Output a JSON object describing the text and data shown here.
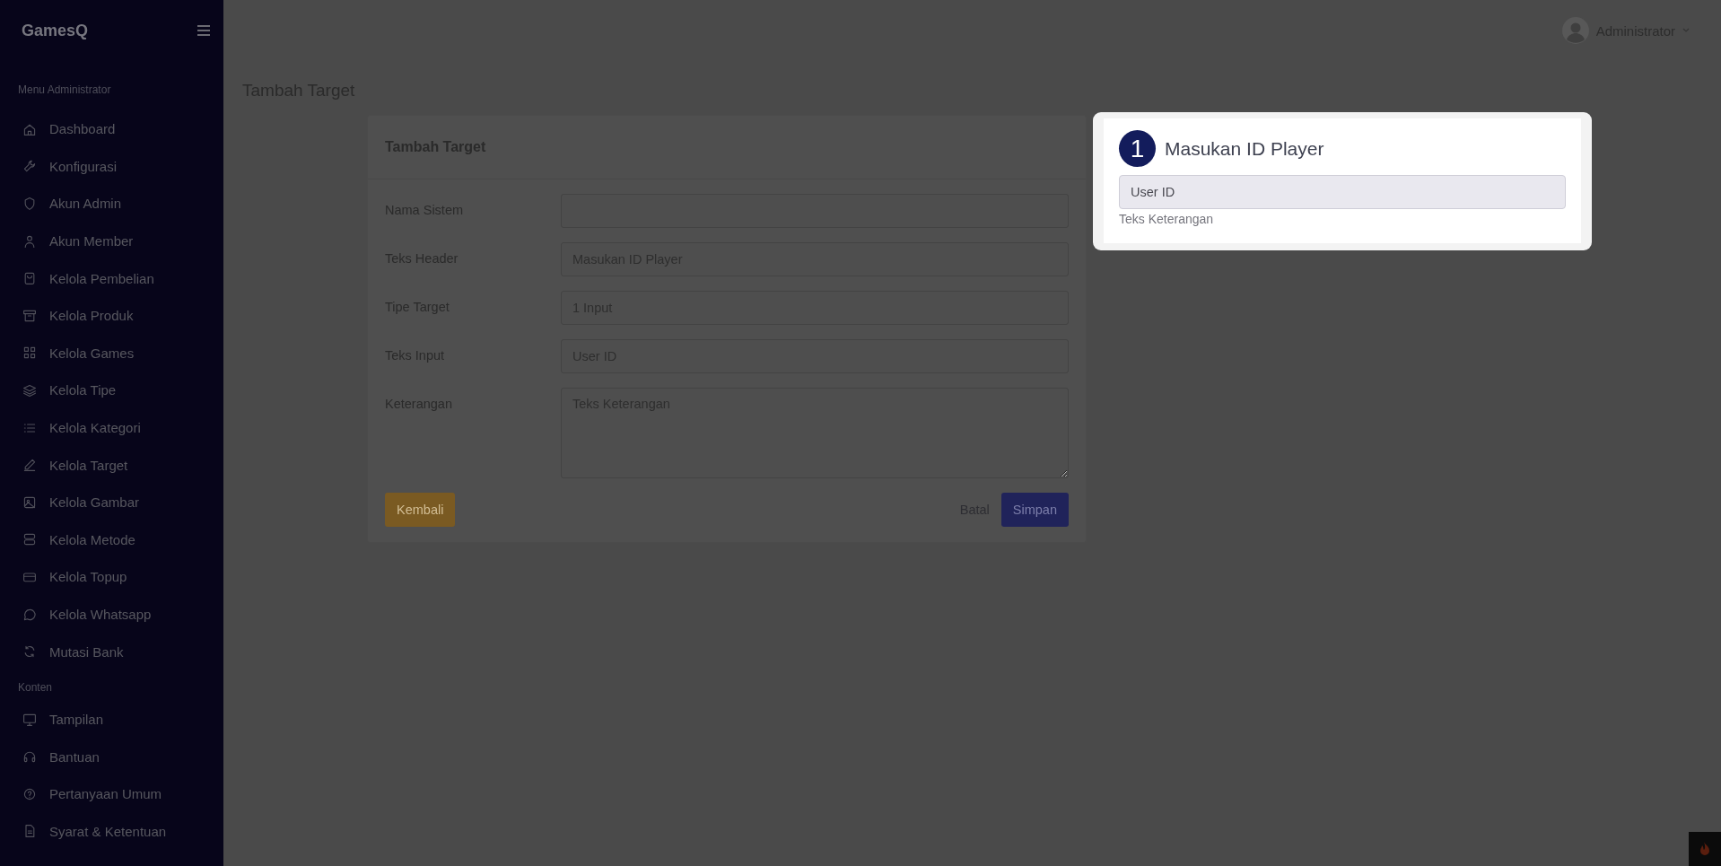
{
  "sidebar": {
    "logo": "GamesQ",
    "sections": [
      {
        "heading": "Menu Administrator",
        "items": [
          {
            "label": "Dashboard"
          },
          {
            "label": "Konfigurasi"
          },
          {
            "label": "Akun Admin"
          },
          {
            "label": "Akun Member"
          },
          {
            "label": "Kelola Pembelian"
          },
          {
            "label": "Kelola Produk"
          },
          {
            "label": "Kelola Games"
          },
          {
            "label": "Kelola Tipe"
          },
          {
            "label": "Kelola Kategori"
          },
          {
            "label": "Kelola Target"
          },
          {
            "label": "Kelola Gambar"
          },
          {
            "label": "Kelola Metode"
          },
          {
            "label": "Kelola Topup"
          },
          {
            "label": "Kelola Whatsapp"
          },
          {
            "label": "Mutasi Bank"
          }
        ]
      },
      {
        "heading": "Konten",
        "items": [
          {
            "label": "Tampilan"
          },
          {
            "label": "Bantuan"
          },
          {
            "label": "Pertanyaan Umum"
          },
          {
            "label": "Syarat & Ketentuan"
          }
        ]
      }
    ]
  },
  "topbar": {
    "user": "Administrator"
  },
  "page_title": "Tambah Target",
  "form": {
    "title": "Tambah Target",
    "fields": [
      {
        "label": "Nama Sistem",
        "kind": "input"
      },
      {
        "label": "Teks Header",
        "kind": "input",
        "value": "Masukan ID Player"
      },
      {
        "label": "Tipe Target",
        "kind": "input",
        "value": "1 Input"
      },
      {
        "label": "Teks Input",
        "kind": "input",
        "value": "User ID"
      },
      {
        "label": "Keterangan",
        "kind": "textarea",
        "value": "Teks Keterangan"
      }
    ],
    "back_button": "Kembali",
    "cancel_link": "Batal",
    "save_button": "Simpan"
  },
  "tour_highlight": {
    "step": "1",
    "title": "Masukan ID Player",
    "input_value": "User ID",
    "help_text": "Teks Keterangan"
  }
}
